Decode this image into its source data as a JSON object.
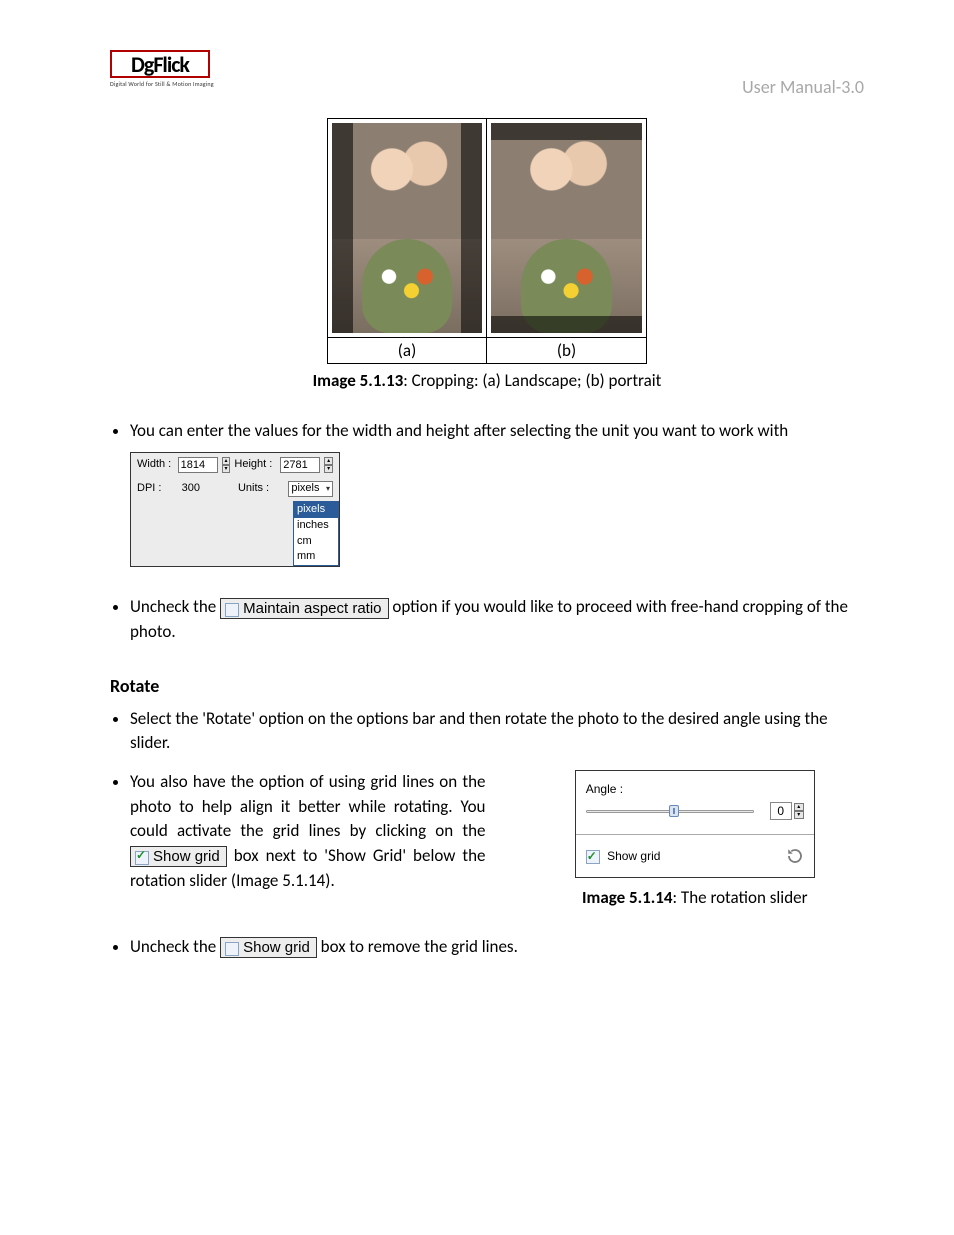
{
  "header": {
    "logo_text": "DgFlick",
    "logo_tagline": "Digital World for Still & Motion Imaging",
    "manual": "User Manual-3.0"
  },
  "fig1": {
    "label_a": "(a)",
    "label_b": "(b)",
    "caption_strong": "Image 5.1.13",
    "caption_rest": ": Cropping: (a) Landscape; (b) portrait"
  },
  "bullets": {
    "b1": "You can enter the values for the width and height after selecting the unit you want to work with",
    "b2_a": "Uncheck the ",
    "b2_chip": "Maintain aspect ratio",
    "b2_b": " option if you would like to proceed with free-hand cropping of the photo.",
    "b3": "Select the 'Rotate' option on the options bar and then rotate the photo to the desired angle using the slider.",
    "b4_a": "You also have the option of using grid lines on the photo to help align it better while rotating. You could activate the grid lines by clicking on the ",
    "b4_chip": "Show grid",
    "b4_b": " box next to 'Show Grid' below the rotation slider (Image 5.1.14).",
    "b5_a": "Uncheck the ",
    "b5_chip": "Show grid",
    "b5_b": " box to remove the grid lines."
  },
  "dims": {
    "width_label": "Width :",
    "width_value": "1814",
    "height_label": "Height :",
    "height_value": "2781",
    "dpi_label": "DPI :",
    "dpi_value": "300",
    "units_label": "Units :",
    "units_value": "pixels",
    "units_options": {
      "o1": "pixels",
      "o2": "inches",
      "o3": "cm",
      "o4": "mm"
    }
  },
  "rotate": {
    "heading": "Rotate",
    "angle_label": "Angle :",
    "angle_value": "0",
    "show_grid_label": "Show grid",
    "caption_strong": "Image 5.1.14",
    "caption_rest": ": The rotation slider"
  }
}
